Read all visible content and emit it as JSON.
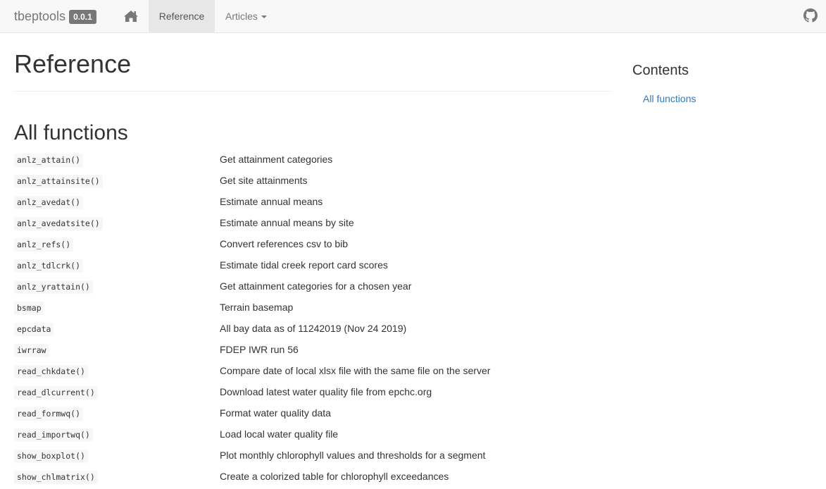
{
  "navbar": {
    "brand": "tbeptools",
    "version": "0.0.1",
    "home_icon": "home-icon",
    "reference_label": "Reference",
    "articles_label": "Articles",
    "github_icon": "github-icon"
  },
  "main": {
    "title": "Reference",
    "section_title": "All functions",
    "functions": [
      {
        "name": "anlz_attain()",
        "description": "Get attainment categories"
      },
      {
        "name": "anlz_attainsite()",
        "description": "Get site attainments"
      },
      {
        "name": "anlz_avedat()",
        "description": "Estimate annual means"
      },
      {
        "name": "anlz_avedatsite()",
        "description": "Estimate annual means by site"
      },
      {
        "name": "anlz_refs()",
        "description": "Convert references csv to bib"
      },
      {
        "name": "anlz_tdlcrk()",
        "description": "Estimate tidal creek report card scores"
      },
      {
        "name": "anlz_yrattain()",
        "description": "Get attainment categories for a chosen year"
      },
      {
        "name": "bsmap",
        "description": "Terrain basemap"
      },
      {
        "name": "epcdata",
        "description": "All bay data as of 11242019 (Nov 24 2019)"
      },
      {
        "name": "iwrraw",
        "description": "FDEP IWR run 56"
      },
      {
        "name": "read_chkdate()",
        "description": "Compare date of local xlsx file with the same file on the server"
      },
      {
        "name": "read_dlcurrent()",
        "description": "Download latest water quality file from epchc.org"
      },
      {
        "name": "read_formwq()",
        "description": "Format water quality data"
      },
      {
        "name": "read_importwq()",
        "description": "Load local water quality file"
      },
      {
        "name": "show_boxplot()",
        "description": "Plot monthly chlorophyll values and thresholds for a segment"
      },
      {
        "name": "show_chlmatrix()",
        "description": "Create a colorized table for chlorophyll exceedances"
      }
    ]
  },
  "sidebar": {
    "title": "Contents",
    "link": "All functions"
  },
  "colors": {
    "link": "#337ab7",
    "navbar_bg": "#f8f8f8",
    "active_tab": "#e7e7e7"
  }
}
